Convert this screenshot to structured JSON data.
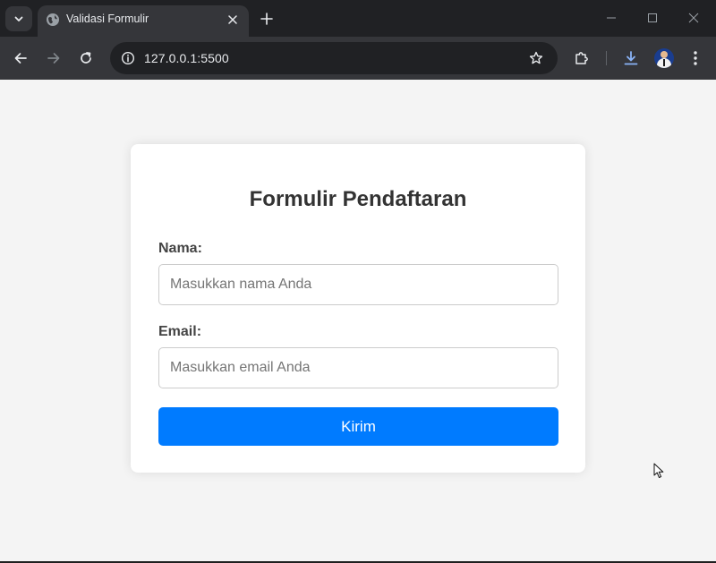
{
  "browser": {
    "tab_title": "Validasi Formulir",
    "url": "127.0.0.1:5500"
  },
  "icons": {
    "tab_search": "chevron-down-icon",
    "favicon": "globe-icon",
    "tab_close": "close-icon",
    "new_tab": "plus-icon",
    "back": "arrow-left-icon",
    "forward": "arrow-right-icon",
    "reload": "reload-icon",
    "site_info": "info-icon",
    "bookmark": "star-icon",
    "extensions": "puzzle-icon",
    "downloads": "download-icon",
    "menu": "kebab-menu-icon"
  },
  "form": {
    "title": "Formulir Pendaftaran",
    "name_label": "Nama:",
    "name_placeholder": "Masukkan nama Anda",
    "email_label": "Email:",
    "email_placeholder": "Masukkan email Anda",
    "submit_label": "Kirim"
  },
  "colors": {
    "accent": "#007bff",
    "page_background": "#f4f4f4",
    "browser_frame": "#202124"
  }
}
